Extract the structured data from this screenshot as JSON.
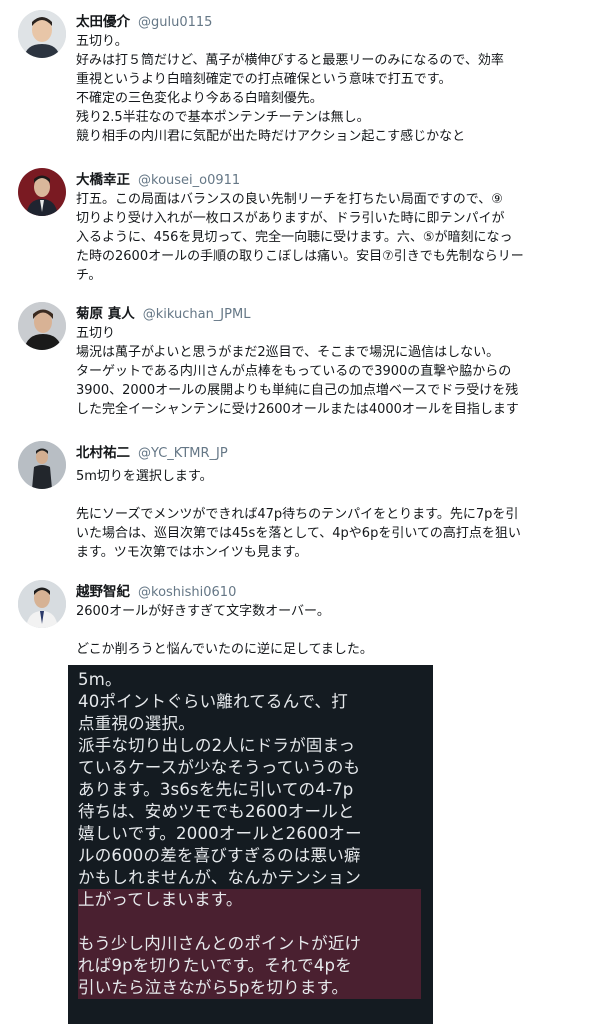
{
  "tweets": [
    {
      "name": "太田優介",
      "handle": "@gulu0115",
      "lines": [
        "五切り。",
        "好みは打５筒だけど、萬子が横伸びすると最悪リーのみになるので、効率",
        "重視というより白暗刻確定での打点確保という意味で打五です。",
        "不確定の三色変化より今ある白暗刻優先。",
        "残り2.5半荘なので基本ポンテンチーテンは無し。",
        "競り相手の内川君に気配が出た時だけアクション起こす感じかなと"
      ]
    },
    {
      "name": "大橋幸正",
      "handle": "@kousei_o0911",
      "lines": [
        "打五。この局面はバランスの良い先制リーチを打ちたい局面ですので、⑨",
        "切りより受け入れが一枚ロスがありますが、ドラ引いた時に即テンパイが",
        "入るように、456を見切って、完全一向聴に受けます。六、⑤が暗刻になっ",
        "た時の2600オールの手順の取りこぼしは痛い。安目⑦引きでも先制ならリー",
        "チ。"
      ]
    },
    {
      "name": "菊原 真人",
      "handle": "@kikuchan_JPML",
      "lines": [
        "五切り",
        "場況は萬子がよいと思うがまだ2巡目で、そこまで場況に過信はしない。",
        "ターゲットである内川さんが点棒をもっているので3900の直撃や脇からの",
        "3900、2000オールの展開よりも単純に自己の加点増ベースでドラ受けを残",
        "した完全イーシャンテンに受け2600オールまたは4000オールを目指します"
      ]
    },
    {
      "name": "北村祐二",
      "handle": "@YC_KTMR_JP",
      "lines": [
        "5m切りを選択します。",
        "",
        "先にソーズでメンツができれば47p待ちのテンパイをとります。先に7pを引",
        "いた場合は、巡目次第では45sを落として、4pや6pを引いての高打点を狙い",
        "ます。ツモ次第ではホンイツも見ます。"
      ]
    },
    {
      "name": "越野智紀",
      "handle": "@koshishi0610",
      "lines": [
        "2600オールが好きすぎて文字数オーバー。",
        "",
        "どこか削ろうと悩んでいたのに逆に足してました。"
      ]
    }
  ],
  "embedded_screenshot": {
    "lines": [
      "5m。",
      "40ポイントぐらい離れてるんで、打",
      "点重視の選択。",
      "派手な切り出しの2人にドラが固まっ",
      "ているケースが少なそうっていうのも",
      "あります。3s6sを先に引いての4-7p",
      "待ちは、安めツモでも2600オールと",
      "嬉しいです。2000オールと2600オー",
      "ルの600の差を喜びすぎるのは悪い癖",
      "かもしれませんが、なんかテンション",
      "上がってしまいます。",
      "",
      "もう少し内川さんとのポイントが近け",
      "れば9pを切りたいです。それで4pを",
      "引いたら泣きながら5pを切ります。"
    ],
    "highlight_color": "#4a2030"
  }
}
